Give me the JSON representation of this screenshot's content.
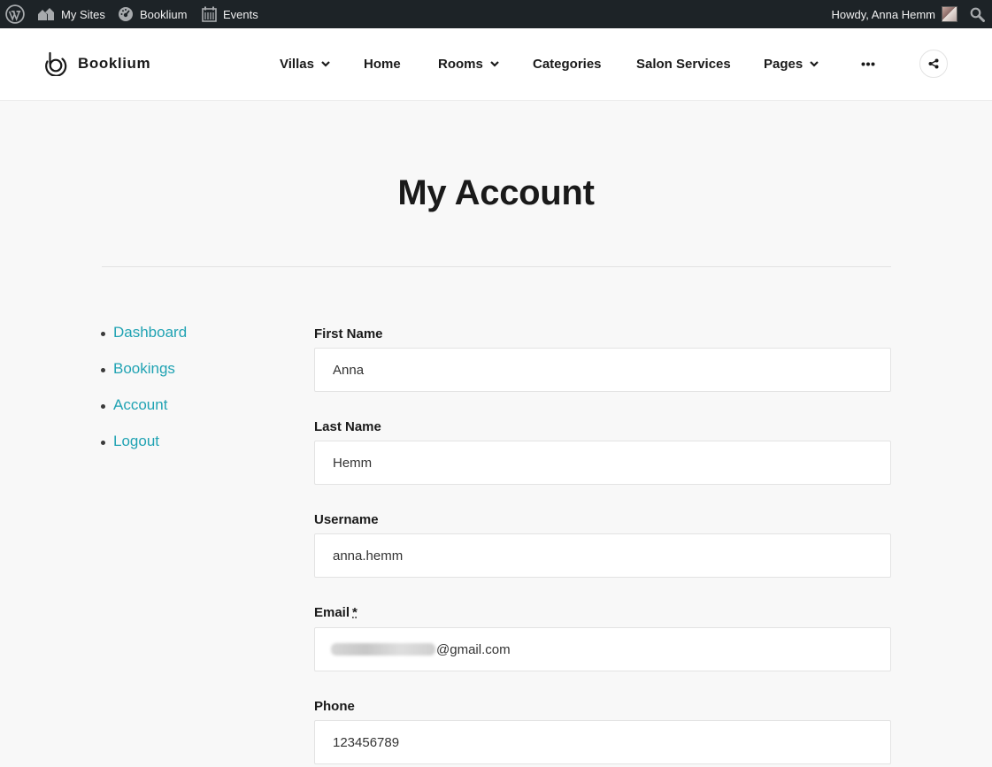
{
  "adminbar": {
    "my_sites": "My Sites",
    "site_name": "Booklium",
    "events": "Events",
    "howdy": "Howdy, Anna Hemm"
  },
  "header": {
    "logo_text": "Booklium",
    "nav": {
      "villas": "Villas",
      "home": "Home",
      "rooms": "Rooms",
      "categories": "Categories",
      "salon_services": "Salon Services",
      "pages": "Pages"
    }
  },
  "page": {
    "title": "My Account"
  },
  "account_nav": {
    "dashboard": "Dashboard",
    "bookings": "Bookings",
    "account": "Account",
    "logout": "Logout"
  },
  "form": {
    "first_name_label": "First Name",
    "first_name_value": "Anna",
    "last_name_label": "Last Name",
    "last_name_value": "Hemm",
    "username_label": "Username",
    "username_value": "anna.hemm",
    "email_label": "Email",
    "email_required": "*",
    "email_domain": "@gmail.com",
    "phone_label": "Phone",
    "phone_value": "123456789"
  },
  "colors": {
    "accent": "#21a3b3",
    "admin_bar": "#1d2327"
  }
}
